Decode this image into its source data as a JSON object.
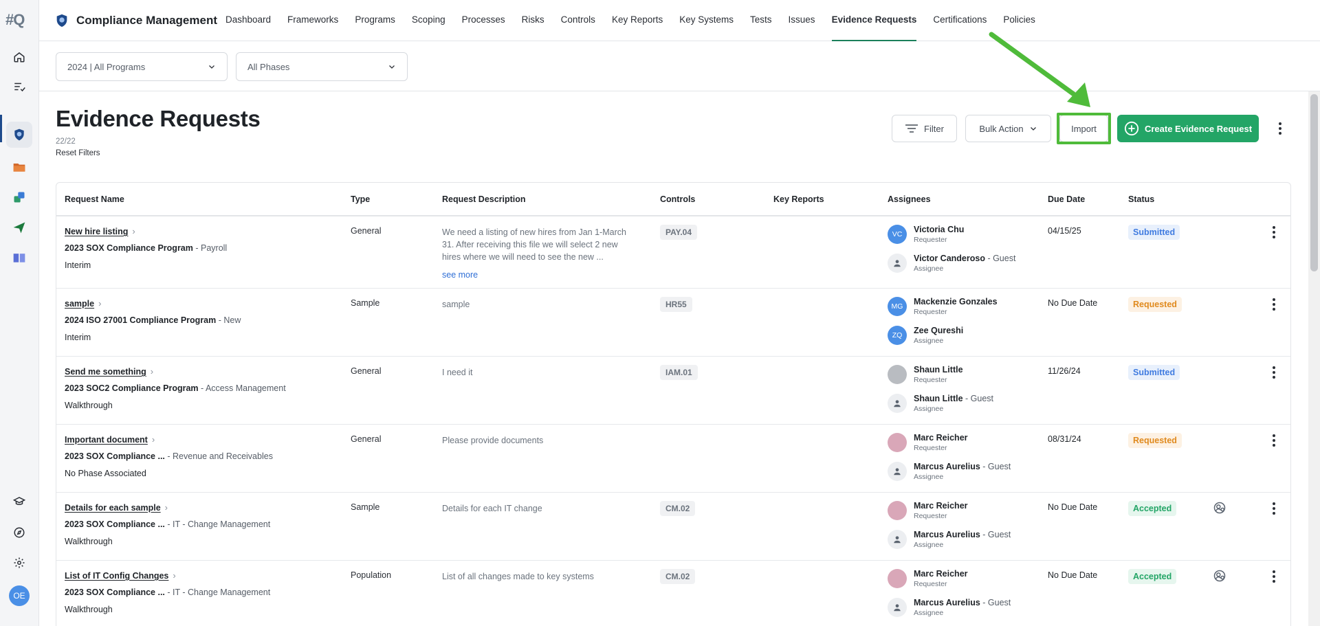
{
  "rail": {
    "logo_main": "#",
    "logo_accent": "Q",
    "user_initials": "OE"
  },
  "header": {
    "brand": "Compliance Management",
    "nav": [
      "Dashboard",
      "Frameworks",
      "Programs",
      "Scoping",
      "Processes",
      "Risks",
      "Controls",
      "Key Reports",
      "Key Systems",
      "Tests",
      "Issues",
      "Evidence Requests",
      "Certifications",
      "Policies"
    ],
    "active_nav": "Evidence Requests"
  },
  "filters": {
    "program": "2024 | All Programs",
    "phase": "All Phases"
  },
  "page": {
    "title": "Evidence Requests",
    "count": "22/22",
    "reset": "Reset Filters"
  },
  "toolbar": {
    "filter": "Filter",
    "bulk": "Bulk Action",
    "import": "Import",
    "create": "Create Evidence Request"
  },
  "colors": {
    "primary": "#23a566",
    "highlight": "#4fbb3a",
    "submitted": "#3f7be0",
    "requested": "#e08a1e",
    "accepted": "#23a566"
  },
  "table": {
    "headers": {
      "name": "Request Name",
      "type": "Type",
      "desc": "Request Description",
      "controls": "Controls",
      "key_reports": "Key Reports",
      "assignees": "Assignees",
      "due": "Due Date",
      "status": "Status"
    },
    "rows": [
      {
        "name": "New hire listing",
        "program": "2023 SOX Compliance Program",
        "program_sub": " - Payroll",
        "phase": "Interim",
        "type": "General",
        "desc1": "We need a listing of new hires from Jan 1-March",
        "desc2": "31. After receiving this file we will select 2 new",
        "desc3": "hires where we will need to see the new ...",
        "see_more": "see more",
        "control": "PAY.04",
        "a1_initials": "VC",
        "a1_name": "Victoria Chu",
        "a1_role": "Requester",
        "a2_name": "Victor Canderoso",
        "a2_guest": " - Guest",
        "a2_role": "Assignee",
        "due": "04/15/25",
        "status": "Submitted"
      },
      {
        "name": "sample",
        "program": "2024 ISO 27001 Compliance Program",
        "program_sub": " - New",
        "phase": "Interim",
        "type": "Sample",
        "desc1": "sample",
        "control": "HR55",
        "a1_initials": "MG",
        "a1_name": "Mackenzie Gonzales",
        "a1_role": "Requester",
        "a2_initials": "ZQ",
        "a2_name": "Zee Qureshi",
        "a2_role": "Assignee",
        "due": "No Due Date",
        "status": "Requested"
      },
      {
        "name": "Send me something",
        "program": "2023 SOC2 Compliance Program",
        "program_sub": " - Access Management",
        "phase": "Walkthrough",
        "type": "General",
        "desc1": "I need it",
        "control": "IAM.01",
        "a1_name": "Shaun Little",
        "a1_role": "Requester",
        "a2_name": "Shaun Little",
        "a2_guest": " - Guest",
        "a2_role": "Assignee",
        "due": "11/26/24",
        "status": "Submitted"
      },
      {
        "name": "Important document",
        "program": "2023 SOX Compliance ...",
        "program_sub": " - Revenue and Receivables",
        "phase": "No Phase Associated",
        "type": "General",
        "desc1": "Please provide documents",
        "control": "",
        "a1_name": "Marc Reicher",
        "a1_role": "Requester",
        "a2_name": "Marcus Aurelius",
        "a2_guest": " - Guest",
        "a2_role": "Assignee",
        "due": "08/31/24",
        "status": "Requested"
      },
      {
        "name": "Details for each sample",
        "program": "2023 SOX Compliance ...",
        "program_sub": " - IT - Change Management",
        "phase": "Walkthrough",
        "type": "Sample",
        "desc1": "Details for each IT change",
        "control": "CM.02",
        "a1_name": "Marc Reicher",
        "a1_role": "Requester",
        "a2_name": "Marcus Aurelius",
        "a2_guest": " - Guest",
        "a2_role": "Assignee",
        "due": "No Due Date",
        "status": "Accepted"
      },
      {
        "name": "List of IT Config Changes",
        "program": "2023 SOX Compliance ...",
        "program_sub": " - IT - Change Management",
        "phase": "Walkthrough",
        "type": "Population",
        "desc1": "List of all changes made to key systems",
        "control": "CM.02",
        "a1_name": "Marc Reicher",
        "a1_role": "Requester",
        "a2_name": "Marcus Aurelius",
        "a2_guest": " - Guest",
        "a2_role": "Assignee",
        "due": "No Due Date",
        "status": "Accepted"
      }
    ]
  }
}
